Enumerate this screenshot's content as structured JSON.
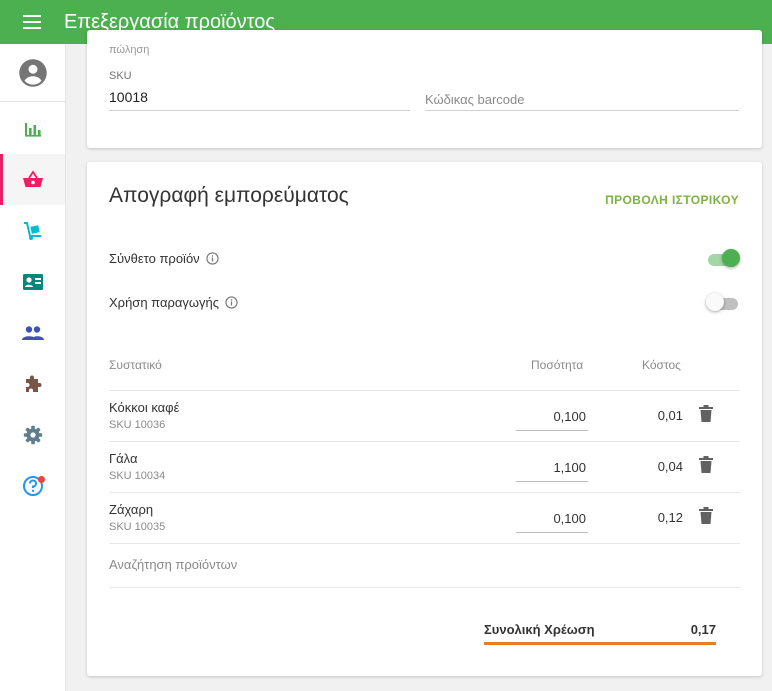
{
  "header": {
    "title": "Επεξεργασία προϊόντος"
  },
  "sidebar": {
    "items": [
      {
        "name": "avatar",
        "color": "#757575"
      },
      {
        "name": "reports",
        "color": "#4caf50"
      },
      {
        "name": "products",
        "color": "#e91e63",
        "active": true
      },
      {
        "name": "orders",
        "color": "#00bcd4"
      },
      {
        "name": "customers",
        "color": "#00897b"
      },
      {
        "name": "users",
        "color": "#3f51b5"
      },
      {
        "name": "extensions",
        "color": "#795548"
      },
      {
        "name": "settings",
        "color": "#607d8b"
      },
      {
        "name": "help",
        "color": "#2196f3"
      }
    ]
  },
  "product_card": {
    "faded_label": "πώληση",
    "sku_label": "SKU",
    "sku_value": "10018",
    "barcode_placeholder": "Κώδικας barcode"
  },
  "inventory": {
    "title": "Απογραφή εμπορεύματος",
    "history_link": "ΠΡΟΒΟΛΗ ΙΣΤΟΡΙΚΟΥ",
    "composite_label": "Σύνθετο προϊόν",
    "composite_on": true,
    "production_label": "Χρήση παραγωγής",
    "production_on": false,
    "columns": {
      "ingredient": "Συστατικό",
      "quantity": "Ποσότητα",
      "cost": "Κόστος"
    },
    "ingredients": [
      {
        "name": "Κόκκοι καφέ",
        "sku": "SKU 10036",
        "quantity": "0,100",
        "cost": "0,01"
      },
      {
        "name": "Γάλα",
        "sku": "SKU 10034",
        "quantity": "1,100",
        "cost": "0,04"
      },
      {
        "name": "Ζάχαρη",
        "sku": "SKU 10035",
        "quantity": "0,100",
        "cost": "0,12"
      }
    ],
    "search_placeholder": "Αναζήτηση προϊόντων",
    "total_label": "Συνολική Χρέωση",
    "total_value": "0,17"
  },
  "colors": {
    "primary": "#4caf50",
    "accent_active": "#e91e63",
    "link": "#7cb342",
    "total_underline": "#e67e22"
  }
}
